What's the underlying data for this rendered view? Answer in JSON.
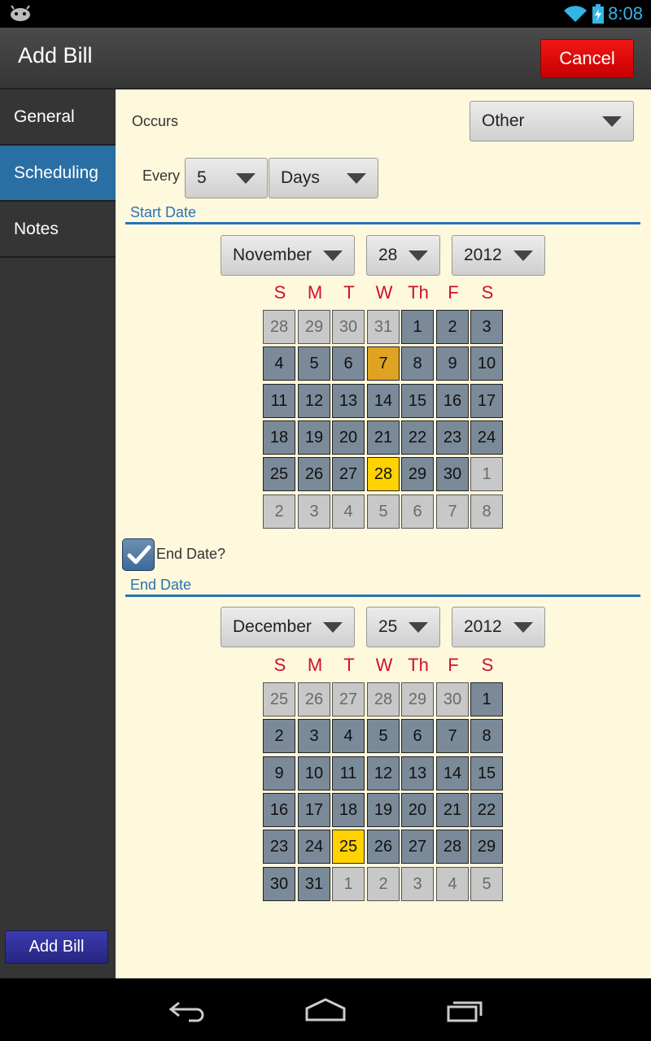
{
  "status_bar": {
    "time": "8:08"
  },
  "action_bar": {
    "title": "Add Bill",
    "cancel_label": "Cancel"
  },
  "sidebar": {
    "items": [
      {
        "label": "General",
        "active": false
      },
      {
        "label": "Scheduling",
        "active": true
      },
      {
        "label": "Notes",
        "active": false
      }
    ],
    "add_bill_label": "Add Bill"
  },
  "form": {
    "occurs_label": "Occurs",
    "occurs_value": "Other",
    "every_label": "Every",
    "every_count": "5",
    "every_unit": "Days",
    "start_date_title": "Start Date",
    "end_date_checkbox_label": "End Date?",
    "end_date_checked": true,
    "end_date_title": "End Date"
  },
  "weekdays": [
    "S",
    "M",
    "T",
    "W",
    "Th",
    "F",
    "S"
  ],
  "start_calendar": {
    "month": "November",
    "day": "28",
    "year": "2012",
    "days": [
      [
        "28",
        "out"
      ],
      [
        "29",
        "out"
      ],
      [
        "30",
        "out"
      ],
      [
        "31",
        "out"
      ],
      [
        "1",
        "in"
      ],
      [
        "2",
        "in"
      ],
      [
        "3",
        "in"
      ],
      [
        "4",
        "in"
      ],
      [
        "5",
        "in"
      ],
      [
        "6",
        "in"
      ],
      [
        "7",
        "event"
      ],
      [
        "8",
        "in"
      ],
      [
        "9",
        "in"
      ],
      [
        "10",
        "in"
      ],
      [
        "11",
        "in"
      ],
      [
        "12",
        "in"
      ],
      [
        "13",
        "in"
      ],
      [
        "14",
        "in"
      ],
      [
        "15",
        "in"
      ],
      [
        "16",
        "in"
      ],
      [
        "17",
        "in"
      ],
      [
        "18",
        "in"
      ],
      [
        "19",
        "in"
      ],
      [
        "20",
        "in"
      ],
      [
        "21",
        "in"
      ],
      [
        "22",
        "in"
      ],
      [
        "23",
        "in"
      ],
      [
        "24",
        "in"
      ],
      [
        "25",
        "in"
      ],
      [
        "26",
        "in"
      ],
      [
        "27",
        "in"
      ],
      [
        "28",
        "sel"
      ],
      [
        "29",
        "in"
      ],
      [
        "30",
        "in"
      ],
      [
        "1",
        "out"
      ],
      [
        "2",
        "out"
      ],
      [
        "3",
        "out"
      ],
      [
        "4",
        "out"
      ],
      [
        "5",
        "out"
      ],
      [
        "6",
        "out"
      ],
      [
        "7",
        "out"
      ],
      [
        "8",
        "out"
      ]
    ]
  },
  "end_calendar": {
    "month": "December",
    "day": "25",
    "year": "2012",
    "days": [
      [
        "25",
        "out"
      ],
      [
        "26",
        "out"
      ],
      [
        "27",
        "out"
      ],
      [
        "28",
        "out"
      ],
      [
        "29",
        "out"
      ],
      [
        "30",
        "out"
      ],
      [
        "1",
        "in"
      ],
      [
        "2",
        "in"
      ],
      [
        "3",
        "in"
      ],
      [
        "4",
        "in"
      ],
      [
        "5",
        "in"
      ],
      [
        "6",
        "in"
      ],
      [
        "7",
        "in"
      ],
      [
        "8",
        "in"
      ],
      [
        "9",
        "in"
      ],
      [
        "10",
        "in"
      ],
      [
        "11",
        "in"
      ],
      [
        "12",
        "in"
      ],
      [
        "13",
        "in"
      ],
      [
        "14",
        "in"
      ],
      [
        "15",
        "in"
      ],
      [
        "16",
        "in"
      ],
      [
        "17",
        "in"
      ],
      [
        "18",
        "in"
      ],
      [
        "19",
        "in"
      ],
      [
        "20",
        "in"
      ],
      [
        "21",
        "in"
      ],
      [
        "22",
        "in"
      ],
      [
        "23",
        "in"
      ],
      [
        "24",
        "in"
      ],
      [
        "25",
        "sel"
      ],
      [
        "26",
        "in"
      ],
      [
        "27",
        "in"
      ],
      [
        "28",
        "in"
      ],
      [
        "29",
        "in"
      ],
      [
        "30",
        "in"
      ],
      [
        "31",
        "in"
      ],
      [
        "1",
        "out"
      ],
      [
        "2",
        "out"
      ],
      [
        "3",
        "out"
      ],
      [
        "4",
        "out"
      ],
      [
        "5",
        "out"
      ]
    ]
  },
  "colors": {
    "accent_blue": "#2a72b5",
    "cancel_red": "#e00000",
    "weekday_red": "#d0102f",
    "selected_day": "#ffd200",
    "event_day": "#e0a321"
  }
}
